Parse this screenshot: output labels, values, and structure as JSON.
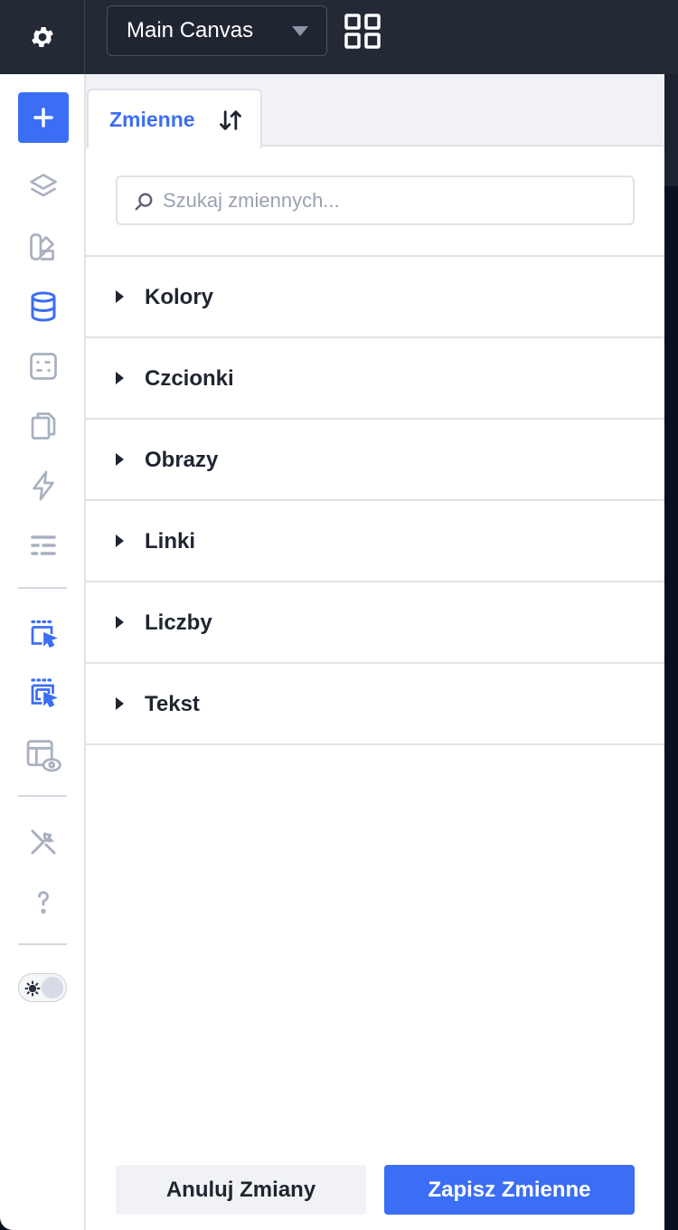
{
  "topbar": {
    "canvas_select": {
      "value": "Main Canvas"
    }
  },
  "sidebar": {
    "icons": [
      "gear-icon",
      "plus-icon",
      "layers-icon",
      "palette-icon",
      "database-icon",
      "form-icon",
      "pages-icon",
      "lightning-icon",
      "sliders-icon",
      "select-cursor-icon",
      "multi-select-cursor-icon",
      "layout-preview-icon",
      "tools-icon",
      "help-icon",
      "theme-toggle"
    ]
  },
  "panel": {
    "tab": {
      "label": "Zmienne"
    },
    "search": {
      "placeholder": "Szukaj zmiennych..."
    },
    "groups": [
      {
        "label": "Kolory"
      },
      {
        "label": "Czcionki"
      },
      {
        "label": "Obrazy"
      },
      {
        "label": "Linki"
      },
      {
        "label": "Liczby"
      },
      {
        "label": "Tekst"
      }
    ],
    "footer": {
      "cancel_label": "Anuluj Zmiany",
      "save_label": "Zapisz Zmienne"
    }
  },
  "colors": {
    "accent": "#3b6ef5",
    "topbar_bg": "#232a36",
    "icon_gray": "#a9b0c0",
    "text_dark": "#1f2530"
  }
}
